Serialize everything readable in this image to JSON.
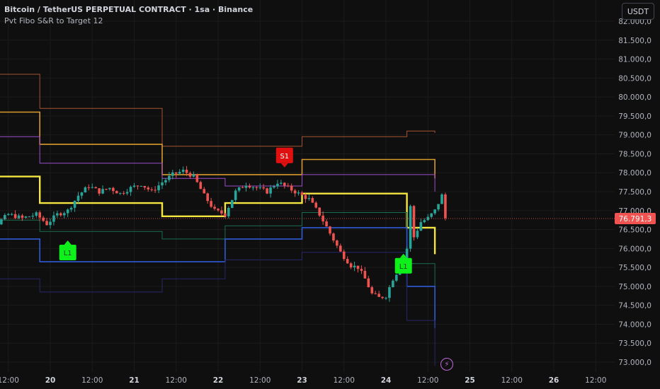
{
  "header": {
    "title": "Bitcoin / TetherUS PERPETUAL CONTRACT · 1sa · Binance",
    "indicator": "Pvt Fibo S&R to Target 12"
  },
  "toolbar": {
    "currency_label": "USDT"
  },
  "icons": {
    "bolt": "lightning-icon"
  },
  "colors": {
    "background": "#0f0f0f",
    "up": "#26a69a",
    "down": "#ef5350",
    "yellow": "#f5e541",
    "orange": "#d99a2b",
    "purple": "#9c4dcc",
    "blue": "#2f5bd6",
    "green": "#1b6e51",
    "darkorange": "#a3542f",
    "navy": "#27276b",
    "price_tag": "#f05350"
  },
  "chart_data": {
    "type": "candlestick",
    "symbol": "Bitcoin / TetherUS PERPETUAL CONTRACT",
    "interval": "1sa",
    "exchange": "Binance",
    "ylim": [
      72800,
      82500
    ],
    "y_ticks": [
      "82.000,0",
      "81.500,0",
      "81.000,0",
      "80.500,0",
      "80.000,0",
      "79.500,0",
      "79.000,0",
      "78.500,0",
      "78.000,0",
      "77.500,0",
      "77.000,0",
      "76.500,0",
      "76.000,0",
      "75.500,0",
      "75.000,0",
      "74.500,0",
      "74.000,0",
      "73.500,0",
      "73.000,0"
    ],
    "y_tick_values": [
      82000,
      81500,
      81000,
      80500,
      80000,
      79500,
      79000,
      78500,
      78000,
      77500,
      77000,
      76500,
      76000,
      75500,
      75000,
      74500,
      74000,
      73500,
      73000
    ],
    "x_ticks": [
      "12:00",
      "20",
      "12:00",
      "21",
      "12:00",
      "22",
      "12:00",
      "23",
      "12:00",
      "24",
      "12:00",
      "25",
      "12:00",
      "26",
      "12:00"
    ],
    "x_tick_hours": [
      -12,
      0,
      12,
      24,
      36,
      48,
      60,
      72,
      84,
      96,
      108,
      120,
      132,
      144,
      156
    ],
    "x_tick_bold": [
      false,
      true,
      false,
      true,
      false,
      true,
      false,
      true,
      false,
      true,
      false,
      true,
      false,
      true,
      false
    ],
    "last_price": 76791.3,
    "last_price_label": "76.791,3",
    "levels": [
      {
        "name": "resistance-3",
        "color": "#a3542f",
        "width": 1,
        "steps": [
          [
            -24,
            80600
          ],
          [
            -3,
            80600
          ],
          [
            -3,
            79700
          ],
          [
            32,
            79700
          ],
          [
            32,
            78700
          ],
          [
            72,
            78700
          ],
          [
            72,
            78950
          ],
          [
            102,
            78950
          ],
          [
            102,
            79100
          ],
          [
            110,
            79100
          ],
          [
            110,
            79050
          ]
        ]
      },
      {
        "name": "resistance-2",
        "color": "#d99a2b",
        "width": 1.6,
        "steps": [
          [
            -24,
            79600
          ],
          [
            -3,
            79600
          ],
          [
            -3,
            78750
          ],
          [
            32,
            78750
          ],
          [
            32,
            77950
          ],
          [
            72,
            77950
          ],
          [
            72,
            78350
          ],
          [
            102,
            78350
          ],
          [
            102,
            78350
          ],
          [
            110,
            78350
          ],
          [
            110,
            77850
          ]
        ]
      },
      {
        "name": "resistance-1",
        "color": "#9c4dcc",
        "width": 1,
        "steps": [
          [
            -24,
            78950
          ],
          [
            -3,
            78950
          ],
          [
            -3,
            78250
          ],
          [
            32,
            78250
          ],
          [
            32,
            77850
          ],
          [
            50,
            77850
          ],
          [
            50,
            77650
          ],
          [
            72,
            77650
          ],
          [
            72,
            77950
          ],
          [
            102,
            77950
          ],
          [
            102,
            77950
          ],
          [
            110,
            77950
          ],
          [
            110,
            77500
          ]
        ]
      },
      {
        "name": "pivot",
        "color": "#f5e541",
        "width": 2.4,
        "steps": [
          [
            -24,
            77900
          ],
          [
            -3,
            77900
          ],
          [
            -3,
            77200
          ],
          [
            32,
            77200
          ],
          [
            32,
            76850
          ],
          [
            50,
            76850
          ],
          [
            50,
            77200
          ],
          [
            72,
            77200
          ],
          [
            72,
            77450
          ],
          [
            102,
            77450
          ],
          [
            102,
            76550
          ],
          [
            110,
            76550
          ],
          [
            110,
            75850
          ]
        ]
      },
      {
        "name": "support-1",
        "color": "#1b6e51",
        "width": 1,
        "steps": [
          [
            -24,
            76750
          ],
          [
            -3,
            76750
          ],
          [
            -3,
            76450
          ],
          [
            32,
            76450
          ],
          [
            32,
            76250
          ],
          [
            50,
            76250
          ],
          [
            50,
            76600
          ],
          [
            72,
            76600
          ],
          [
            72,
            76950
          ],
          [
            102,
            76950
          ],
          [
            102,
            75600
          ],
          [
            110,
            75600
          ],
          [
            110,
            74650
          ]
        ]
      },
      {
        "name": "support-2",
        "color": "#2f5bd6",
        "width": 1.6,
        "steps": [
          [
            -24,
            76250
          ],
          [
            -3,
            76250
          ],
          [
            -3,
            75650
          ],
          [
            32,
            75650
          ],
          [
            32,
            75650
          ],
          [
            50,
            75650
          ],
          [
            50,
            76250
          ],
          [
            72,
            76250
          ],
          [
            72,
            76550
          ],
          [
            102,
            76550
          ],
          [
            102,
            75000
          ],
          [
            110,
            75000
          ],
          [
            110,
            73900
          ]
        ]
      },
      {
        "name": "support-3",
        "color": "#27276b",
        "width": 1,
        "steps": [
          [
            -24,
            75200
          ],
          [
            -3,
            75200
          ],
          [
            -3,
            74850
          ],
          [
            32,
            74850
          ],
          [
            32,
            75200
          ],
          [
            50,
            75200
          ],
          [
            50,
            75700
          ],
          [
            72,
            75700
          ],
          [
            72,
            75900
          ],
          [
            102,
            75900
          ],
          [
            102,
            74100
          ],
          [
            110,
            74100
          ],
          [
            110,
            72900
          ]
        ]
      }
    ],
    "close_path": [
      [
        -24,
        76700
      ],
      [
        -20,
        77000
      ],
      [
        -16,
        76600
      ],
      [
        -12,
        76900
      ],
      [
        -8,
        76800
      ],
      [
        -4,
        76900
      ],
      [
        -1,
        76650
      ],
      [
        2,
        76900
      ],
      [
        5,
        77000
      ],
      [
        8,
        77400
      ],
      [
        11,
        77650
      ],
      [
        14,
        77500
      ],
      [
        17,
        77600
      ],
      [
        20,
        77450
      ],
      [
        23,
        77600
      ],
      [
        26,
        77700
      ],
      [
        29,
        77500
      ],
      [
        32,
        77750
      ],
      [
        35,
        77950
      ],
      [
        38,
        78050
      ],
      [
        41,
        77900
      ],
      [
        44,
        77400
      ],
      [
        47,
        77000
      ],
      [
        50,
        76900
      ],
      [
        53,
        77500
      ],
      [
        56,
        77700
      ],
      [
        59,
        77600
      ],
      [
        62,
        77500
      ],
      [
        65,
        77750
      ],
      [
        68,
        77600
      ],
      [
        71,
        77450
      ],
      [
        74,
        77300
      ],
      [
        77,
        76900
      ],
      [
        80,
        76400
      ],
      [
        83,
        75900
      ],
      [
        86,
        75550
      ],
      [
        88,
        75500
      ],
      [
        90,
        75200
      ],
      [
        92,
        74800
      ],
      [
        94,
        74700
      ],
      [
        96,
        74750
      ],
      [
        98,
        75200
      ],
      [
        100,
        75500
      ],
      [
        102,
        76000
      ],
      [
        103,
        77100
      ],
      [
        104,
        76300
      ],
      [
        106,
        76700
      ],
      [
        108,
        76800
      ],
      [
        110,
        77000
      ],
      [
        112,
        77400
      ],
      [
        113,
        76800
      ]
    ],
    "signals": [
      {
        "label": "S1",
        "type": "sell",
        "hour": 67,
        "price": 78400,
        "color": "#e01010"
      },
      {
        "label": "L1",
        "type": "buy",
        "hour": 5,
        "price": 75950,
        "color": "#0ef01a"
      },
      {
        "label": "L1",
        "type": "buy",
        "hour": 101,
        "price": 75600,
        "color": "#0ef01a"
      }
    ]
  }
}
